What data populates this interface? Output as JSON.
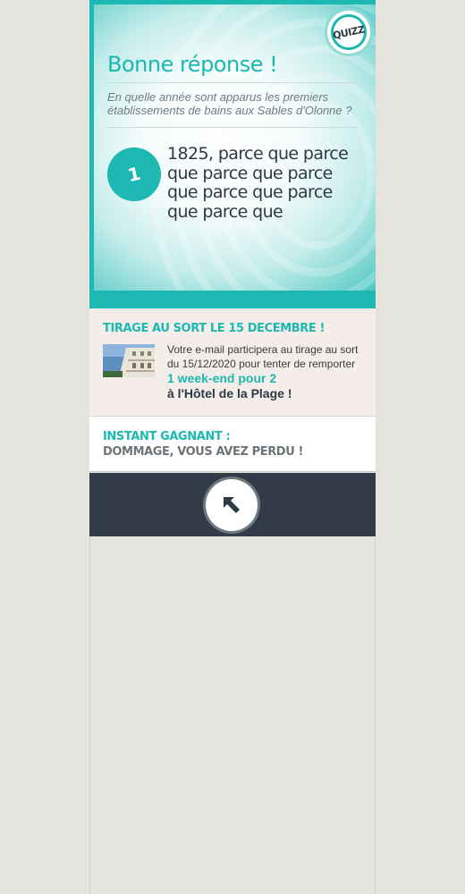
{
  "brand": {
    "badge_label": "QUIZZ",
    "accent_color": "#1cb8b1",
    "dark_color": "#323c48"
  },
  "result": {
    "title": "Bonne réponse !",
    "question": "En quelle année sont apparus les premiers établissements de bains aux Sables d'Olonne ?",
    "answer_number": "1",
    "answer_text": "1825, parce que parce que parce que parce que parce que parce que parce que"
  },
  "draw": {
    "heading": "TIRAGE AU SORT LE 15 DECEMBRE !",
    "image_icon": "hotel-photo",
    "text_intro": "Votre e-mail participera au tirage au sort du 15/12/2020 pour tenter de remporter",
    "text_highlight": "1 week-end pour 2",
    "text_end": "à l'Hôtel de la Plage !"
  },
  "instant": {
    "heading": "INSTANT GAGNANT :",
    "result": "DOMMAGE, VOUS AVEZ PERDU !"
  },
  "footer": {
    "back_icon": "arrow-up-left-icon"
  }
}
